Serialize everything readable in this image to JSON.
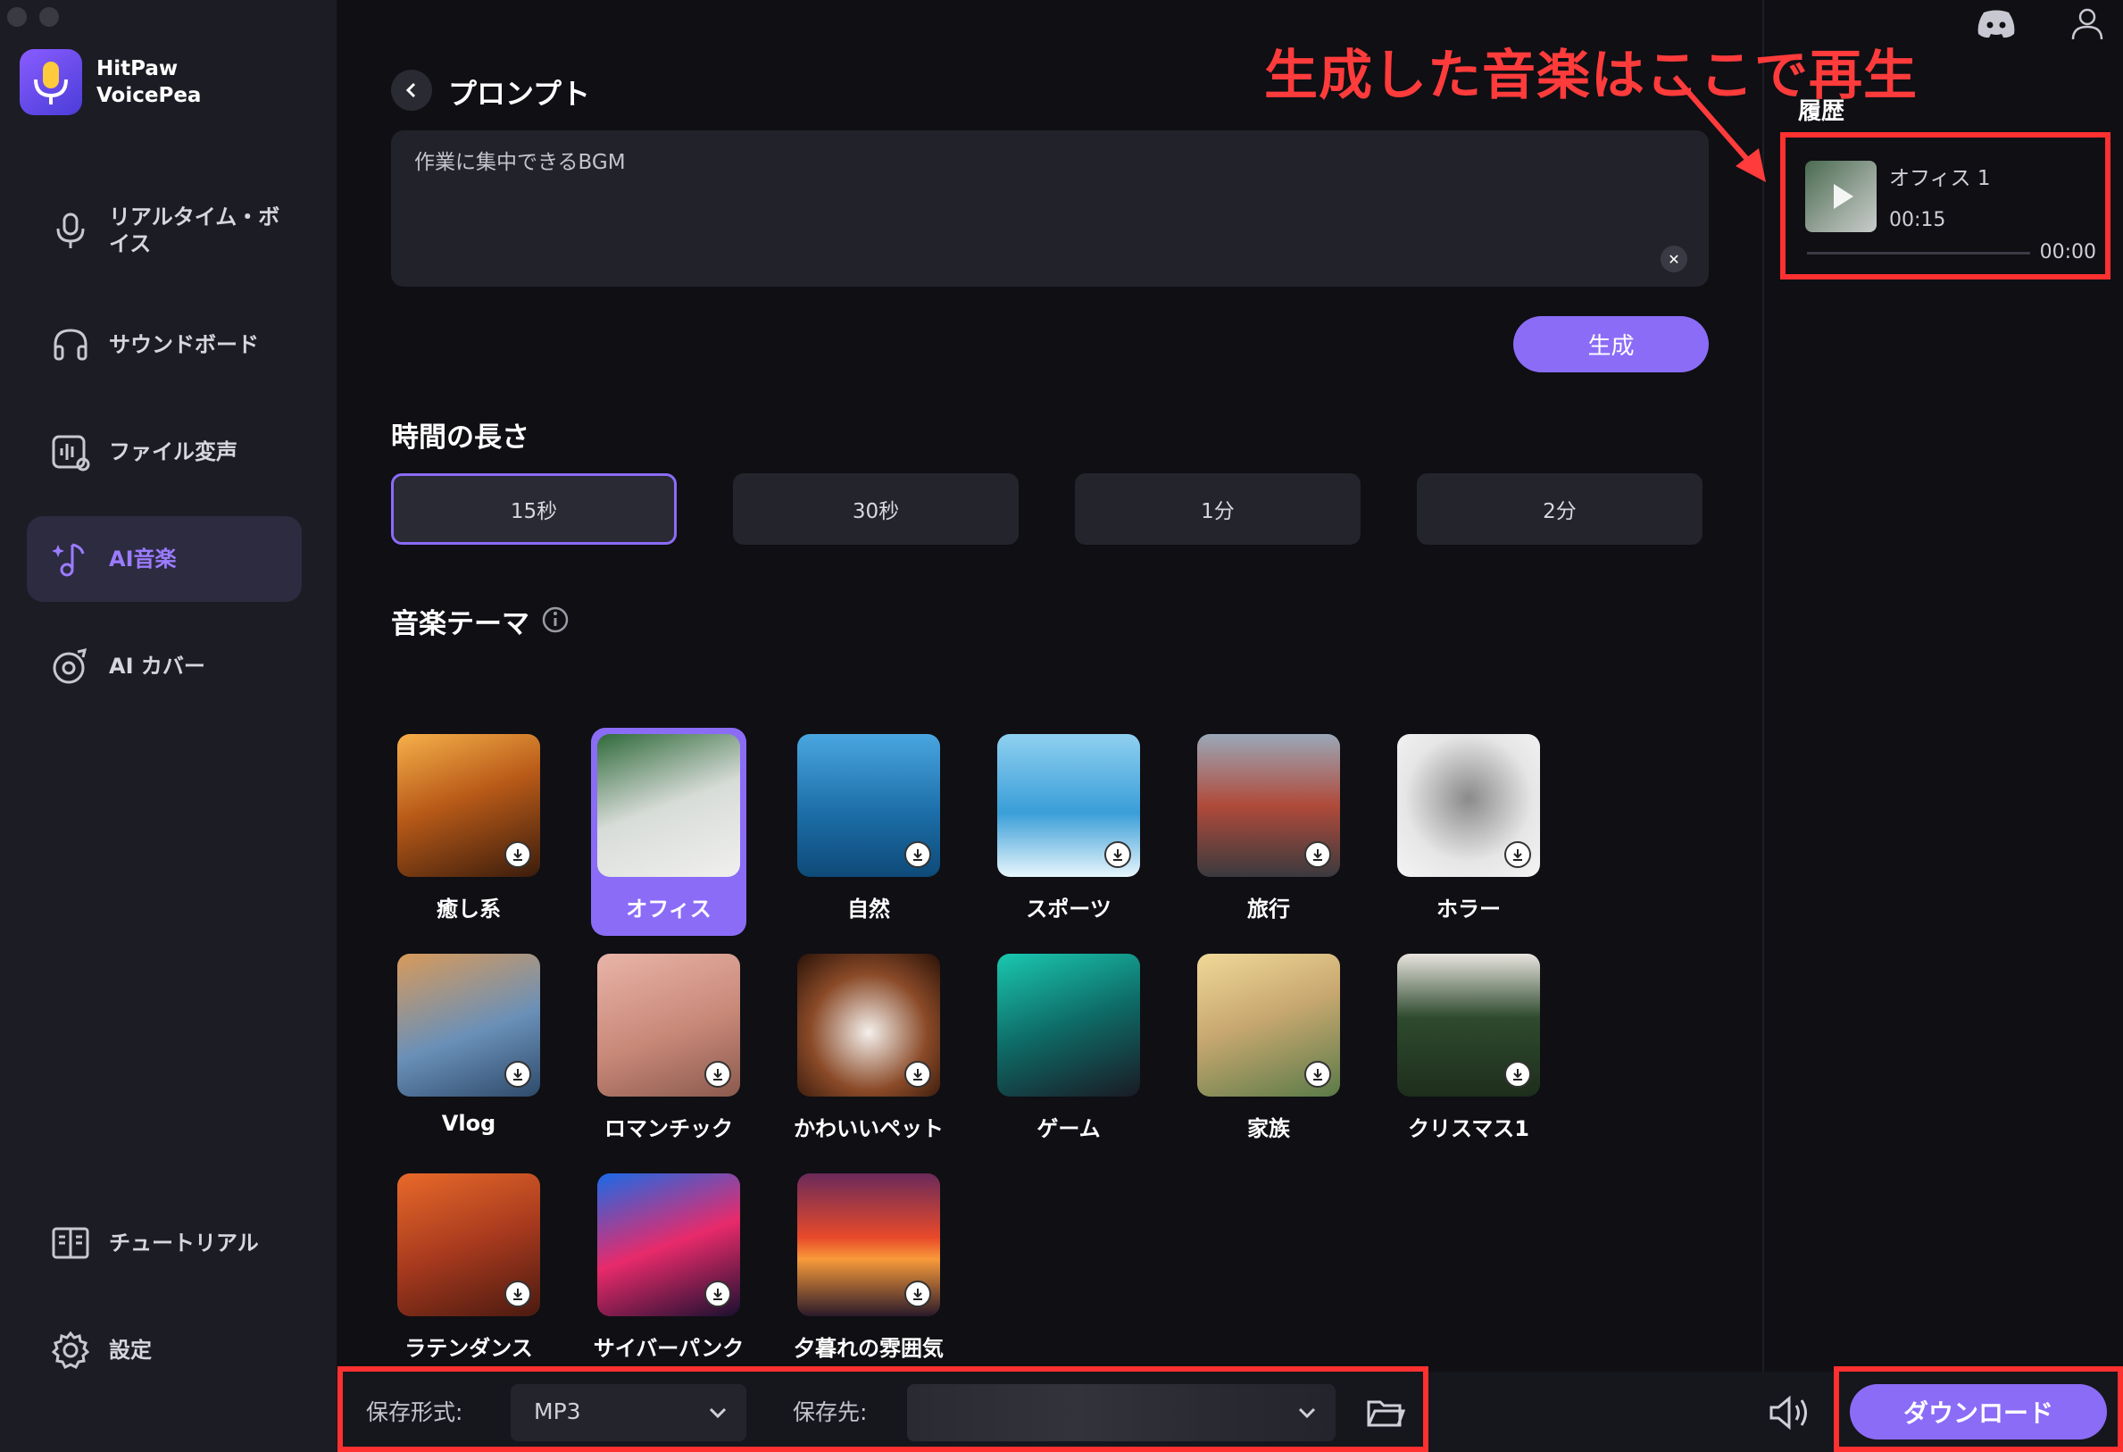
{
  "app": {
    "name_line1": "HitPaw",
    "name_line2": "VoicePea"
  },
  "sidebar": {
    "items": [
      {
        "label": "リアルタイム・ボイス",
        "icon": "mic-icon"
      },
      {
        "label": "サウンドボード",
        "icon": "headphones-icon"
      },
      {
        "label": "ファイル変声",
        "icon": "file-voice-icon"
      },
      {
        "label": "AI音楽",
        "icon": "ai-music-icon",
        "active": true
      },
      {
        "label": "AI カバー",
        "icon": "ai-cover-icon"
      }
    ],
    "bottom_items": [
      {
        "label": "チュートリアル",
        "icon": "book-icon"
      },
      {
        "label": "設定",
        "icon": "gear-icon"
      }
    ]
  },
  "prompt": {
    "title": "プロンプト",
    "text": "作業に集中できるBGM",
    "generate_label": "生成"
  },
  "duration": {
    "title": "時間の長さ",
    "options": [
      "15秒",
      "30秒",
      "1分",
      "2分"
    ],
    "selected": "15秒"
  },
  "themes": {
    "title": "音楽テーマ",
    "items": [
      {
        "label": "癒し系"
      },
      {
        "label": "オフィス",
        "selected": true
      },
      {
        "label": "自然"
      },
      {
        "label": "スポーツ"
      },
      {
        "label": "旅行"
      },
      {
        "label": "ホラー"
      },
      {
        "label": "Vlog"
      },
      {
        "label": "ロマンチック"
      },
      {
        "label": "かわいいペット"
      },
      {
        "label": "ゲーム"
      },
      {
        "label": "家族"
      },
      {
        "label": "クリスマス1"
      },
      {
        "label": "ラテンダンス"
      },
      {
        "label": "サイバーパンク"
      },
      {
        "label": "夕暮れの雰囲気"
      }
    ]
  },
  "history": {
    "title": "履歴",
    "item": {
      "name": "オフィス 1",
      "duration": "00:15",
      "position": "00:00"
    }
  },
  "annotation": "生成した音楽はここで再生",
  "bottom": {
    "format_label": "保存形式:",
    "format_value": "MP3",
    "dest_label": "保存先:",
    "download_label": "ダウンロード"
  },
  "colors": {
    "accent": "#8b6cf6",
    "highlight": "#ff3030"
  }
}
